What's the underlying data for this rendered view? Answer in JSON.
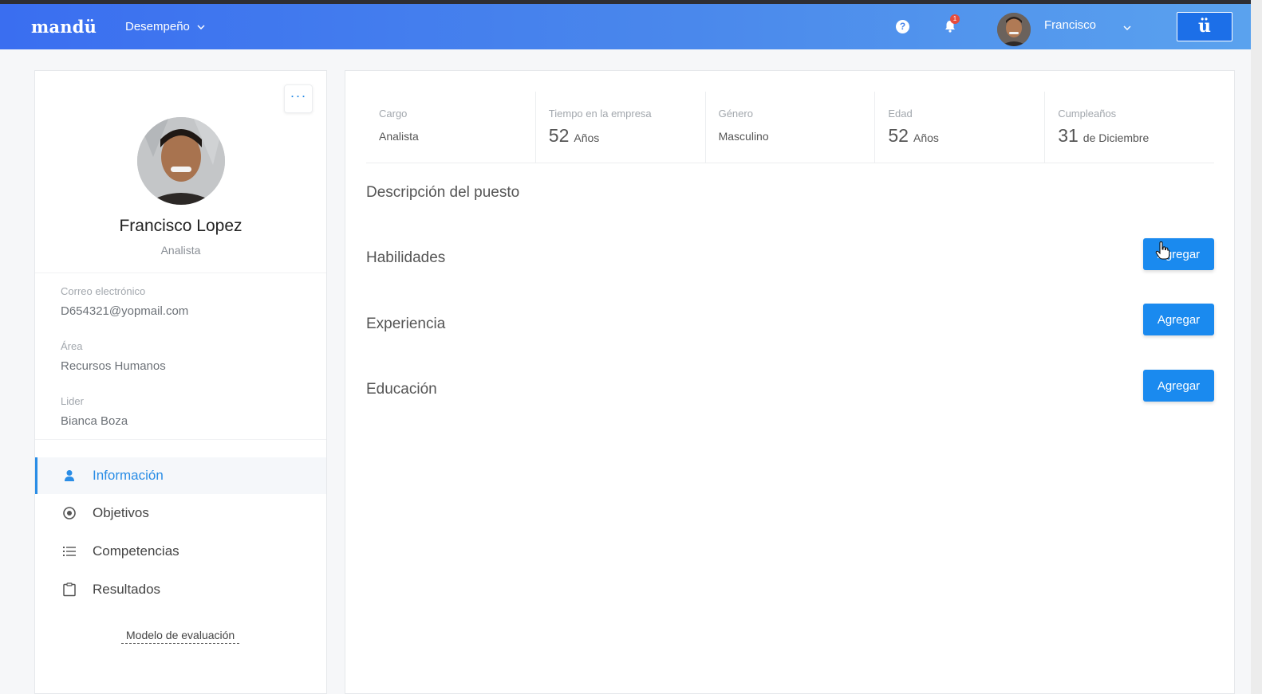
{
  "nav": {
    "logo": "mandü",
    "menu_label": "Desempeño",
    "help_glyph": "?",
    "notifications_count": "1",
    "user_name": "Francisco",
    "brand_glyph": "ü"
  },
  "profile": {
    "name": "Francisco Lopez",
    "role": "Analista",
    "more_glyph": "···",
    "fields": [
      {
        "label": "Correo electrónico",
        "value": "D654321@yopmail.com"
      },
      {
        "label": "Área",
        "value": "Recursos Humanos"
      },
      {
        "label": "Lider",
        "value": "Bianca Boza"
      }
    ],
    "menu": [
      {
        "label": "Información",
        "icon": "user-icon",
        "active": true
      },
      {
        "label": "Objetivos",
        "icon": "target-icon",
        "active": false
      },
      {
        "label": "Competencias",
        "icon": "list-icon",
        "active": false
      },
      {
        "label": "Resultados",
        "icon": "clipboard-icon",
        "active": false
      }
    ],
    "eval_link": "Modelo de evaluación"
  },
  "stats": [
    {
      "label": "Cargo",
      "value": "Analista"
    },
    {
      "label": "Tiempo en la empresa",
      "number": "52",
      "unit": "Años"
    },
    {
      "label": "Género",
      "value": "Masculino"
    },
    {
      "label": "Edad",
      "number": "52",
      "unit": "Años"
    },
    {
      "label": "Cumpleaños",
      "number": "31",
      "unit": "de Diciembre"
    }
  ],
  "sections": {
    "description": "Descripción del puesto",
    "skills": "Habilidades",
    "experience": "Experiencia",
    "education": "Educación",
    "add_label": "Agregar"
  },
  "colors": {
    "accent": "#1a8aef",
    "nav_gradient_start": "#3a6ef0",
    "nav_gradient_end": "#5aa2ee"
  }
}
